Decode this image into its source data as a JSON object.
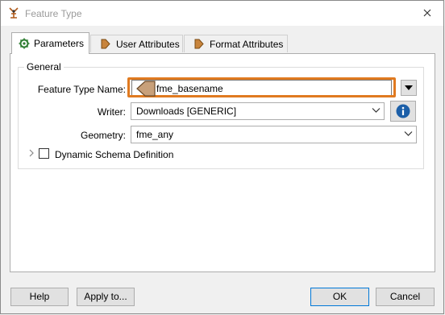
{
  "window": {
    "title": "Feature Type"
  },
  "tabs": [
    {
      "label": "Parameters",
      "icon": "gear-icon"
    },
    {
      "label": "User Attributes",
      "icon": "attribute-arrow-icon"
    },
    {
      "label": "Format Attributes",
      "icon": "attribute-arrow-icon"
    }
  ],
  "general": {
    "title": "General",
    "feature_type_name": {
      "label": "Feature Type Name:",
      "value": "fme_basename"
    },
    "writer": {
      "label": "Writer:",
      "value": "Downloads [GENERIC]"
    },
    "geometry": {
      "label": "Geometry:",
      "value": "fme_any"
    },
    "dynamic_schema": {
      "label": "Dynamic Schema Definition",
      "checked": false
    }
  },
  "buttons": {
    "help": "Help",
    "apply_to": "Apply to...",
    "ok": "OK",
    "cancel": "Cancel"
  },
  "colors": {
    "highlight": "#e07a20",
    "info": "#1c5fa8"
  }
}
